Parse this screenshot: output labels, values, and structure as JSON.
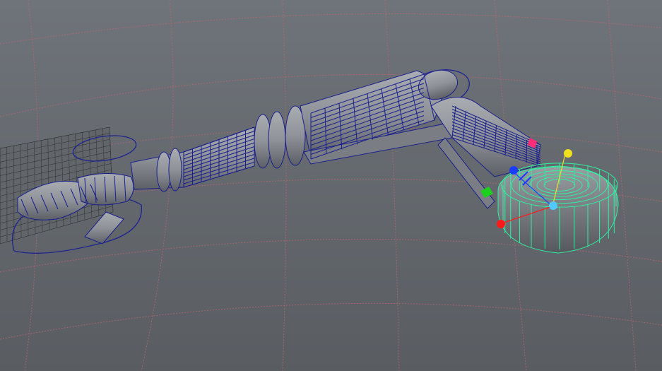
{
  "viewport": {
    "background_top": "#6f747a",
    "background_bottom": "#595d62"
  },
  "colors": {
    "grid": "#b86470",
    "mesh_fill": "#8f9399",
    "mesh_fill_dark": "#5c6066",
    "wire": "#1a1f8c",
    "selected_wire": "#2df0a0",
    "selected_fill": "#7d8187",
    "hand_grid": "#34383c",
    "curve": "#1c2290",
    "handle_red": "#ff1a1a",
    "handle_green": "#1ed01e",
    "handle_blue": "#1a3cff",
    "handle_yellow": "#f0e020",
    "handle_cyan": "#52c8ff",
    "handle_magenta": "#ff2a78"
  },
  "icons": {
    "manipulator": "transform-manipulator-icon",
    "ik_handle": "ik-handle-icon"
  }
}
